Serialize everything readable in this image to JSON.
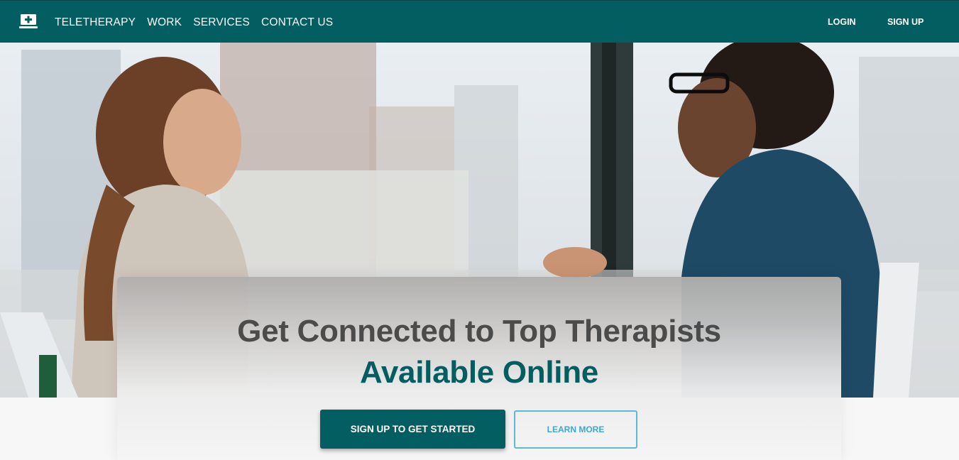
{
  "nav": {
    "logo_icon": "monitor-plus-icon",
    "links": [
      "TELETHERAPY",
      "WORK",
      "SERVICES",
      "CONTACT US"
    ],
    "login": "LOGIN",
    "signup": "SIGN UP"
  },
  "hero": {
    "headline_line1": "Get Connected to Top Therapists",
    "headline_line2": "Available Online",
    "primary_button": "SIGN UP TO GET STARTED",
    "secondary_button": "LEARN MORE"
  },
  "colors": {
    "brand": "#035e62",
    "accent_outline": "#5db9d6",
    "heading_gray": "#4b4b4b"
  }
}
